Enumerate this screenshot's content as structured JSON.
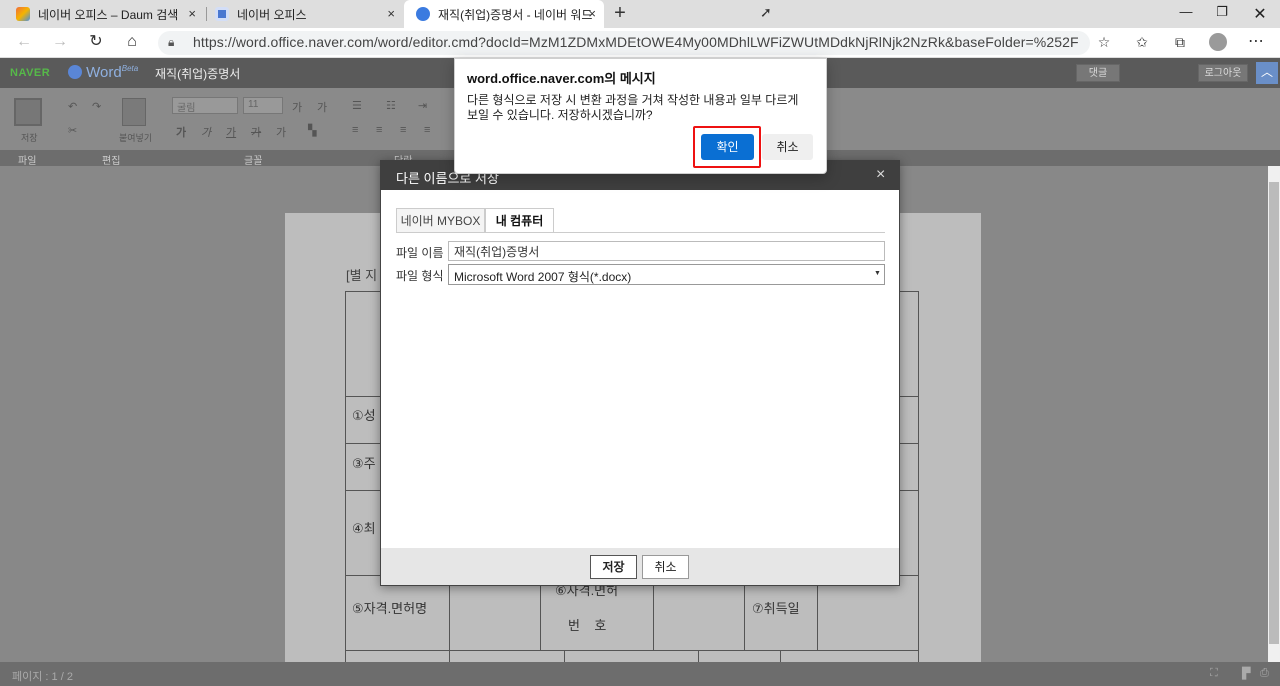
{
  "browser": {
    "tabs": [
      {
        "title": "네이버 오피스 – Daum 검색",
        "favicon_color": "#f06c3c"
      },
      {
        "title": "네이버 오피스",
        "favicon_color": "#4a78d1"
      },
      {
        "title": "재직(취업)증명서 - 네이버 워드",
        "favicon_color": "#3b7be0"
      }
    ],
    "close_glyph": "×",
    "new_tab_glyph": "+",
    "url": "https://word.office.naver.com/word/editor.cmd?docId=MzM1ZDMxMDEtOWE4My00MDhlLWFiZWUtMDdkNjRlNjk2NzRk&baseFolder=%252F"
  },
  "app": {
    "naver_logo": "NAVER",
    "word_logo": "Word",
    "beta": "Beta",
    "doc_title": "재직(취업)증명서",
    "comment_btn": "댓글",
    "logout_btn": "로그아웃",
    "ribbon": {
      "save_label": "저장",
      "paste_label": "붙여넣기",
      "font_name": "굴림",
      "font_size": "11",
      "groups": [
        "파일",
        "편집",
        "글꼴",
        "단락"
      ]
    },
    "status_page": "페이지 : 1 / 2"
  },
  "document": {
    "attachment_label": "[별 지",
    "rows": [
      {
        "label": "①성"
      },
      {
        "label": "③주"
      },
      {
        "label": "④최"
      },
      {
        "label": "⑤자격.면허명",
        "mid": "⑥자격.면허",
        "mid2": "번    호",
        "right": "⑦취득일"
      }
    ]
  },
  "save_dialog": {
    "title": "다른 이름으로 저장",
    "tabs": [
      "네이버 MYBOX",
      "내 컴퓨터"
    ],
    "file_name_label": "파일 이름",
    "file_name_value": "재직(취업)증명서",
    "file_type_label": "파일 형식",
    "file_type_value": "Microsoft Word 2007 형식(*.docx)",
    "save_btn": "저장",
    "cancel_btn": "취소"
  },
  "alert": {
    "title": "word.office.naver.com의 메시지",
    "message": "다른 형식으로 저장 시 변환 과정을 거쳐 작성한 내용과 일부 다르게 보일 수 있습니다. 저장하시겠습니까?",
    "ok": "확인",
    "cancel": "취소"
  }
}
